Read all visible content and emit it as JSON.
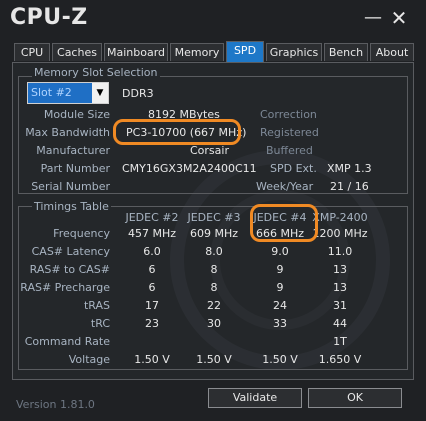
{
  "window": {
    "title": "CPU-Z",
    "minimize": "—",
    "close": "✕"
  },
  "tabs": [
    "CPU",
    "Caches",
    "Mainboard",
    "Memory",
    "SPD",
    "Graphics",
    "Bench",
    "About"
  ],
  "active_tab": "SPD",
  "memory_slot": {
    "group_label": "Memory Slot Selection",
    "slot_value": "Slot #2",
    "type": "DDR3",
    "module_size_label": "Module Size",
    "module_size": "8192 MBytes",
    "max_bandwidth_label": "Max Bandwidth",
    "max_bandwidth": "PC3-10700 (667 MHz)",
    "manufacturer_label": "Manufacturer",
    "manufacturer": "Corsair",
    "part_number_label": "Part Number",
    "part_number": "CMY16GX3M2A2400C11",
    "serial_number_label": "Serial Number",
    "correction_label": "Correction",
    "registered_label": "Registered",
    "buffered_label": "Buffered",
    "spd_ext_label": "SPD Ext.",
    "spd_ext": "XMP 1.3",
    "week_year_label": "Week/Year",
    "week_year": "21 / 16"
  },
  "timings": {
    "group_label": "Timings Table",
    "columns": [
      "JEDEC #2",
      "JEDEC #3",
      "JEDEC #4",
      "XMP-2400"
    ],
    "rows": [
      {
        "label": "Frequency",
        "values": [
          "457 MHz",
          "609 MHz",
          "666 MHz",
          "1200 MHz"
        ]
      },
      {
        "label": "CAS# Latency",
        "values": [
          "6.0",
          "8.0",
          "9.0",
          "11.0"
        ]
      },
      {
        "label": "RAS# to CAS#",
        "values": [
          "6",
          "8",
          "9",
          "13"
        ]
      },
      {
        "label": "RAS# Precharge",
        "values": [
          "6",
          "8",
          "9",
          "13"
        ]
      },
      {
        "label": "tRAS",
        "values": [
          "17",
          "22",
          "24",
          "31"
        ]
      },
      {
        "label": "tRC",
        "values": [
          "23",
          "30",
          "33",
          "44"
        ]
      },
      {
        "label": "Command Rate",
        "values": [
          "",
          "",
          "",
          "1T"
        ]
      },
      {
        "label": "Voltage",
        "values": [
          "1.50 V",
          "1.50 V",
          "1.50 V",
          "1.650 V"
        ]
      }
    ]
  },
  "footer": {
    "version": "Version 1.81.0",
    "validate_label": "Validate",
    "ok_label": "OK"
  },
  "colors": {
    "accent": "#1e78c8",
    "highlight": "#f08a24"
  }
}
